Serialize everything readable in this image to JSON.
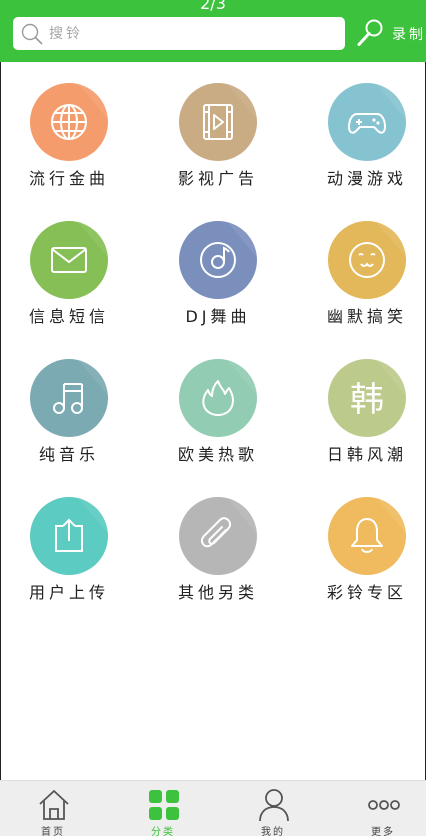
{
  "header": {
    "page_indicator": "2/3",
    "search_placeholder": "搜铃",
    "record_label": "录制"
  },
  "categories": [
    {
      "label": "流行金曲",
      "icon": "globe-icon",
      "color": "#f59c6c"
    },
    {
      "label": "影视广告",
      "icon": "film-icon",
      "color": "#c9ab84"
    },
    {
      "label": "动漫游戏",
      "icon": "gamepad-icon",
      "color": "#86c3d0"
    },
    {
      "label": "信息短信",
      "icon": "envelope-icon",
      "color": "#86bf56"
    },
    {
      "label": "DJ舞曲",
      "icon": "disc-icon",
      "color": "#7b8fbd"
    },
    {
      "label": "幽默搞笑",
      "icon": "smiley-icon",
      "color": "#e3b85a"
    },
    {
      "label": "纯音乐",
      "icon": "music-note-icon",
      "color": "#7baab2"
    },
    {
      "label": "欧美热歌",
      "icon": "flame-icon",
      "color": "#92ccb2"
    },
    {
      "label": "日韩风潮",
      "icon": "han-character-icon",
      "color": "#bccb8c"
    },
    {
      "label": "用户上传",
      "icon": "upload-icon",
      "color": "#5ccbc1"
    },
    {
      "label": "其他另类",
      "icon": "paperclip-icon",
      "color": "#b6b6b6"
    },
    {
      "label": "彩铃专区",
      "icon": "bell-icon",
      "color": "#efbb5e"
    }
  ],
  "han_glyph": "韩",
  "tabs": [
    {
      "label": "首页",
      "icon": "home-icon",
      "active": false
    },
    {
      "label": "分类",
      "icon": "grid-icon",
      "active": true
    },
    {
      "label": "我的",
      "icon": "user-icon",
      "active": false
    },
    {
      "label": "更多",
      "icon": "more-icon",
      "active": false
    }
  ],
  "colors": {
    "brand_green": "#3cc23c",
    "tabbar_bg": "#eeeeee"
  }
}
